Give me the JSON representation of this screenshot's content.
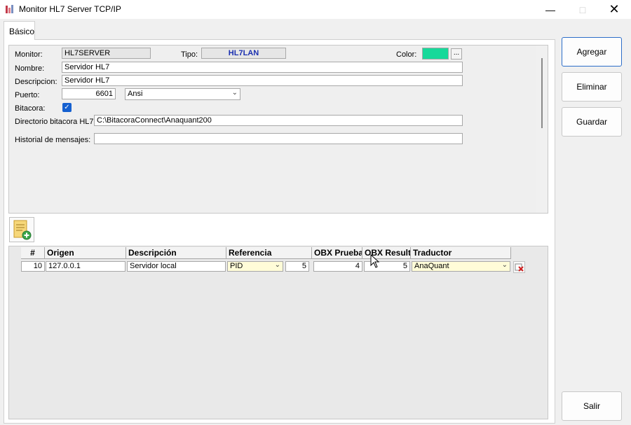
{
  "window": {
    "title": "Monitor HL7 Server TCP/IP"
  },
  "tabs": [
    {
      "label": "Básico"
    }
  ],
  "form": {
    "monitor_label": "Monitor:",
    "monitor_value": "HL7SERVER",
    "tipo_label": "Tipo:",
    "tipo_value": "HL7LAN",
    "color_label": "Color:",
    "color_value": "#17d99a",
    "color_picker_label": "...",
    "nombre_label": "Nombre:",
    "nombre_value": "Servidor HL7",
    "descripcion_label": "Descripcion:",
    "descripcion_value": "Servidor HL7",
    "puerto_label": "Puerto:",
    "puerto_value": "6601",
    "encoding_value": "Ansi",
    "bitacora_label": "Bitacora:",
    "bitacora_checked": true,
    "directorio_label": "Directorio bitacora HL7:",
    "directorio_value": "C:\\BitacoraConnect\\Anaquant200",
    "historial_label": "Historial de mensajes:",
    "historial_value": ""
  },
  "grid": {
    "columns": [
      "#",
      "Origen",
      "Descripción",
      "Referencia",
      "OBX Prueba",
      "OBX Result",
      "Traductor"
    ],
    "rows": [
      {
        "num": "10",
        "origen": "127.0.0.1",
        "descripcion": "Servidor local",
        "referencia": "PID",
        "referencia_n": "5",
        "obx_prueba": "4",
        "obx_result": "5",
        "traductor": "AnaQuant"
      }
    ]
  },
  "actions": {
    "agregar": "Agregar",
    "eliminar": "Eliminar",
    "guardar": "Guardar",
    "salir": "Salir"
  },
  "icons": {
    "app": "monitor-app-icon",
    "add_row": "add-document-icon",
    "delete_row": "delete-row-icon"
  }
}
